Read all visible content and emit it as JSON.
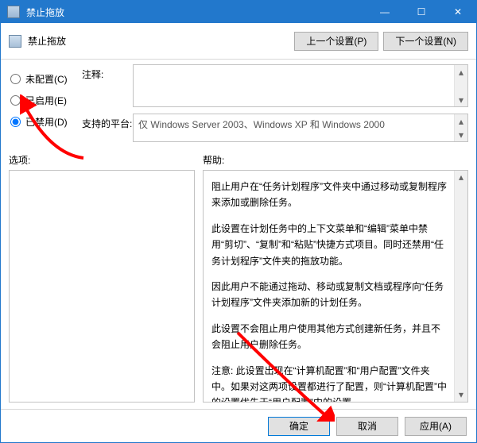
{
  "window": {
    "title": "禁止拖放"
  },
  "winbtns": {
    "min": "—",
    "max": "☐",
    "close": "✕"
  },
  "toolbar": {
    "caption": "禁止拖放",
    "prev_label": "上一个设置(P)",
    "next_label": "下一个设置(N)"
  },
  "radios": {
    "unconfigured": "未配置(C)",
    "enabled": "已启用(E)",
    "disabled": "已禁用(D)",
    "selected": "disabled"
  },
  "fields": {
    "comment_label": "注释:",
    "platform_label": "支持的平台:",
    "platform_value": "仅 Windows Server 2003、Windows XP 和 Windows 2000"
  },
  "labels": {
    "options": "选项:",
    "help": "帮助:"
  },
  "help": {
    "p1": "阻止用户在“任务计划程序”文件夹中通过移动或复制程序来添加或删除任务。",
    "p2": "此设置在计划任务中的上下文菜单和“编辑”菜单中禁用“剪切”、“复制”和“粘贴”快捷方式项目。同时还禁用“任务计划程序”文件夹的拖放功能。",
    "p3": "因此用户不能通过拖动、移动或复制文档或程序向“任务计划程序”文件夹添加新的计划任务。",
    "p4": "此设置不会阻止用户使用其他方式创建新任务，并且不会阻止用户删除任务。",
    "p5": "注意: 此设置出现在“计算机配置”和“用户配置”文件夹中。如果对这两项设置都进行了配置，则“计算机配置”中的设置优先于“用户配置”中的设置。"
  },
  "footer": {
    "ok": "确定",
    "cancel": "取消",
    "apply": "应用(A)"
  }
}
